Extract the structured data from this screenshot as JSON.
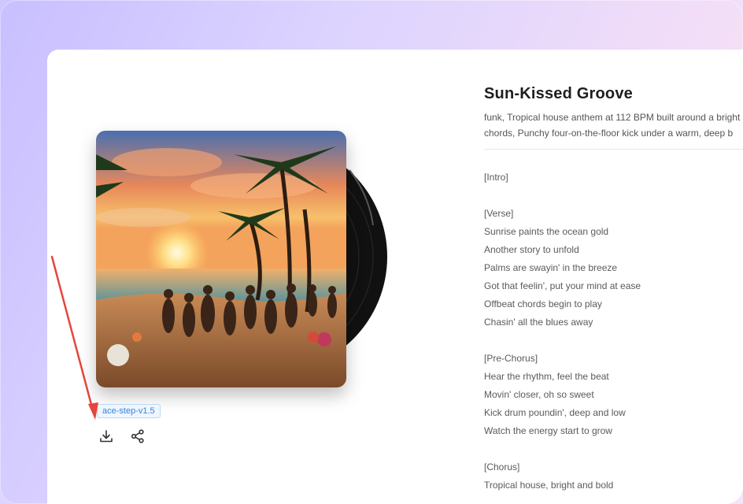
{
  "song": {
    "title": "Sun-Kissed Groove",
    "description_line1": "funk, Tropical house anthem at 112 BPM built around a bright",
    "description_line2": "chords, Punchy four-on-the-floor kick under a warm, deep b"
  },
  "model_tag": "ace-step-v1.5",
  "actions": {
    "download_icon": "download-icon",
    "share_icon": "share-icon"
  },
  "lyrics": [
    {
      "text": "[Intro]"
    },
    {
      "text": ""
    },
    {
      "text": "[Verse]"
    },
    {
      "text": "Sunrise paints the ocean gold"
    },
    {
      "text": "Another story to unfold"
    },
    {
      "text": "Palms are swayin' in the breeze"
    },
    {
      "text": "Got that feelin', put your mind at ease"
    },
    {
      "text": "Offbeat chords begin to play"
    },
    {
      "text": "Chasin' all the blues away"
    },
    {
      "text": ""
    },
    {
      "text": "[Pre-Chorus]"
    },
    {
      "text": "Hear the rhythm, feel the beat"
    },
    {
      "text": "Movin' closer, oh so sweet"
    },
    {
      "text": "Kick drum poundin', deep and low"
    },
    {
      "text": "Watch the energy start to grow"
    },
    {
      "text": ""
    },
    {
      "text": "[Chorus]"
    },
    {
      "text": "Tropical house, bright and bold"
    }
  ],
  "colors": {
    "accent_arrow": "#e5463b",
    "tag_text": "#3b82d6"
  }
}
